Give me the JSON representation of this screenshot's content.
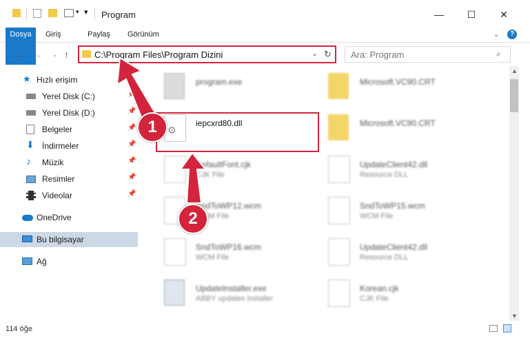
{
  "window": {
    "title": "Program",
    "minimize": "—",
    "maximize": "☐",
    "close": "✕"
  },
  "ribbon": {
    "tabs": [
      "Dosya",
      "Giriş",
      "Paylaş",
      "Görünüm"
    ]
  },
  "address": {
    "path": "C:\\Program Files\\Program Dizini"
  },
  "search": {
    "placeholder": "Ara: Program"
  },
  "sidebar": {
    "items": [
      {
        "label": "Hızlı erişim",
        "icon": "star-icon"
      },
      {
        "label": "Yerel Disk (C:)",
        "icon": "drive-icon",
        "pinned": true
      },
      {
        "label": "Yerel Disk (D:)",
        "icon": "drive-icon",
        "pinned": true
      },
      {
        "label": "Belgeler",
        "icon": "document-icon",
        "pinned": true
      },
      {
        "label": "İndirmeler",
        "icon": "download-icon",
        "pinned": true
      },
      {
        "label": "Müzik",
        "icon": "music-icon",
        "pinned": true
      },
      {
        "label": "Resimler",
        "icon": "pictures-icon",
        "pinned": true
      },
      {
        "label": "Videolar",
        "icon": "video-icon",
        "pinned": true
      },
      {
        "label": "OneDrive",
        "icon": "cloud-icon"
      },
      {
        "label": "Bu bilgisayar",
        "icon": "computer-icon",
        "selected": true
      },
      {
        "label": "Ağ",
        "icon": "network-icon"
      }
    ]
  },
  "files": [
    {
      "name": "program.exe",
      "type": ""
    },
    {
      "name": "Microsoft.VC90.CRT",
      "type": ""
    },
    {
      "name": "iepcxrd80.dll",
      "type": ""
    },
    {
      "name": "Microsoft.VC90.CRT",
      "type": ""
    },
    {
      "name": "DefaultFont.cjk",
      "type": "CJK File"
    },
    {
      "name": "UpdateClient42.dll",
      "type": "Resource DLL"
    },
    {
      "name": "SndToWP12.wcm",
      "type": "WCM File"
    },
    {
      "name": "SndToWP15.wcm",
      "type": "WCM File"
    },
    {
      "name": "SndToWP16.wcm",
      "type": "WCM File"
    },
    {
      "name": "UpdateClient42.dll",
      "type": "Resource DLL"
    },
    {
      "name": "UpdateInstaller.exe",
      "type": "ABBY updates installer"
    },
    {
      "name": "Korean.cjk",
      "type": "CJK File"
    }
  ],
  "status": {
    "count": "114 öğe"
  },
  "callouts": [
    "1",
    "2"
  ],
  "colors": {
    "accent": "#1979ca",
    "highlight": "#d3243c"
  }
}
